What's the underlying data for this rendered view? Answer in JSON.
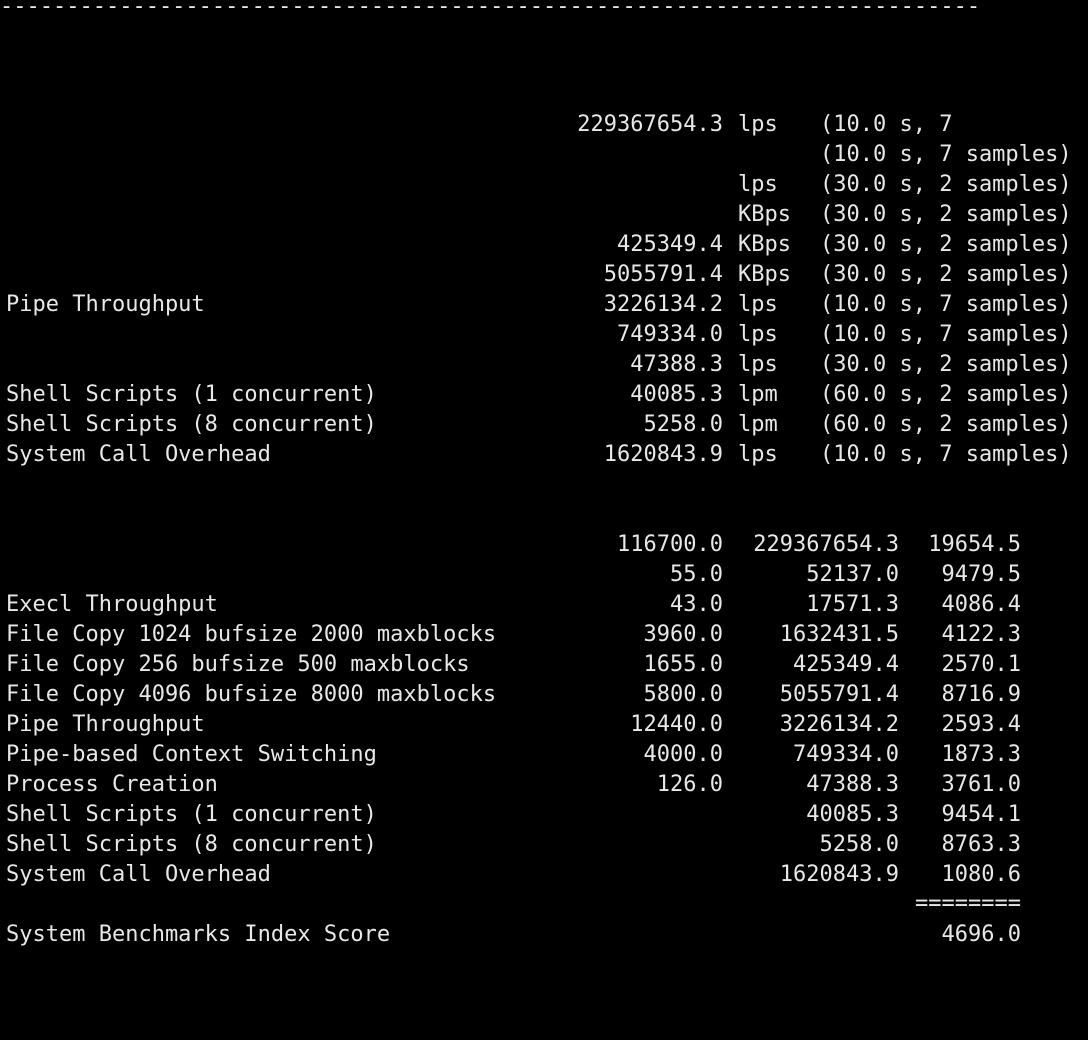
{
  "separator": "--------------------------------------------------------------------------",
  "results": [
    {
      "label": "",
      "value": "229367654.3",
      "unit": "lps",
      "detail": "(10.0 s, 7"
    },
    {
      "label": "",
      "value": "",
      "unit": "",
      "detail": "(10.0 s, 7 samples)"
    },
    {
      "label": "",
      "value": "",
      "unit": "lps",
      "detail": "(30.0 s, 2 samples)"
    },
    {
      "label": "",
      "value": "",
      "unit": "KBps",
      "detail": "(30.0 s, 2 samples)"
    },
    {
      "label": "",
      "value": "425349.4",
      "unit": "KBps",
      "detail": "(30.0 s, 2 samples)"
    },
    {
      "label": "",
      "value": "5055791.4",
      "unit": "KBps",
      "detail": "(30.0 s, 2 samples)"
    },
    {
      "label": "Pipe Throughput",
      "value": "3226134.2",
      "unit": "lps",
      "detail": "(10.0 s, 7 samples)"
    },
    {
      "label": "",
      "value": "749334.0",
      "unit": "lps",
      "detail": "(10.0 s, 7 samples)"
    },
    {
      "label": "",
      "value": "47388.3",
      "unit": "lps",
      "detail": "(30.0 s, 2 samples)"
    },
    {
      "label": "Shell Scripts (1 concurrent)",
      "value": "40085.3",
      "unit": "lpm",
      "detail": "(60.0 s, 2 samples)"
    },
    {
      "label": "Shell Scripts (8 concurrent)",
      "value": "5258.0",
      "unit": "lpm",
      "detail": "(60.0 s, 2 samples)"
    },
    {
      "label": "System Call Overhead",
      "value": "1620843.9",
      "unit": "lps",
      "detail": "(10.0 s, 7 samples)"
    }
  ],
  "index_rows": [
    {
      "label": "",
      "baseline": "116700.0",
      "result": "229367654.3",
      "index": "19654.5"
    },
    {
      "label": "",
      "baseline": "55.0",
      "result": "52137.0",
      "index": "9479.5"
    },
    {
      "label": "Execl Throughput",
      "baseline": "43.0",
      "result": "17571.3",
      "index": "4086.4"
    },
    {
      "label": "File Copy 1024 bufsize 2000 maxblocks",
      "baseline": "3960.0",
      "result": "1632431.5",
      "index": "4122.3"
    },
    {
      "label": "File Copy 256 bufsize 500 maxblocks",
      "baseline": "1655.0",
      "result": "425349.4",
      "index": "2570.1"
    },
    {
      "label": "File Copy 4096 bufsize 8000 maxblocks",
      "baseline": "5800.0",
      "result": "5055791.4",
      "index": "8716.9"
    },
    {
      "label": "Pipe Throughput",
      "baseline": "12440.0",
      "result": "3226134.2",
      "index": "2593.4"
    },
    {
      "label": "Pipe-based Context Switching",
      "baseline": "4000.0",
      "result": "749334.0",
      "index": "1873.3"
    },
    {
      "label": "Process Creation",
      "baseline": "126.0",
      "result": "47388.3",
      "index": "3761.0"
    },
    {
      "label": "Shell Scripts (1 concurrent)",
      "baseline": "",
      "result": "40085.3",
      "index": "9454.1"
    },
    {
      "label": "Shell Scripts (8 concurrent)",
      "baseline": "",
      "result": "5258.0",
      "index": "8763.3"
    },
    {
      "label": "System Call Overhead",
      "baseline": "",
      "result": "1620843.9",
      "index": "1080.6"
    }
  ],
  "score_rule": "========",
  "score": {
    "label": "System Benchmarks Index Score",
    "value": "4696.0"
  }
}
